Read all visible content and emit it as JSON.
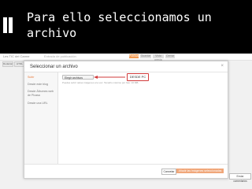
{
  "slide": {
    "title_line1": "Para ello seleccionamos un",
    "title_line2": "archivo"
  },
  "app": {
    "brand": "Les TIC del Carme",
    "topbar_text": "Entrada de publicación",
    "topbar_buttons": [
      "Publicar",
      "Guardar",
      "Vista previa",
      "Cerrar"
    ],
    "left_buttons": [
      "Redactar",
      "HTML"
    ]
  },
  "dialog": {
    "title": "Seleccionar un archivo",
    "close": "×",
    "sidebar": [
      "Subir",
      "Desde este blog",
      "Desde Álbumes web de Picasa",
      "Desde una URL"
    ],
    "select_button": "Elegir archivos",
    "hint": "Puedes subir varias imágenes a la vez. Tamaño máximo por foto: 10 MB.",
    "callout": "DESDE PC",
    "cancel": "Cancelar",
    "primary": "Añadir las imágenes seleccionadas"
  },
  "bottom_button": "Enviar comentarios",
  "colors": {
    "accent": "#e8793a",
    "callout_border": "#d23b3b",
    "header_bg": "#000000"
  }
}
